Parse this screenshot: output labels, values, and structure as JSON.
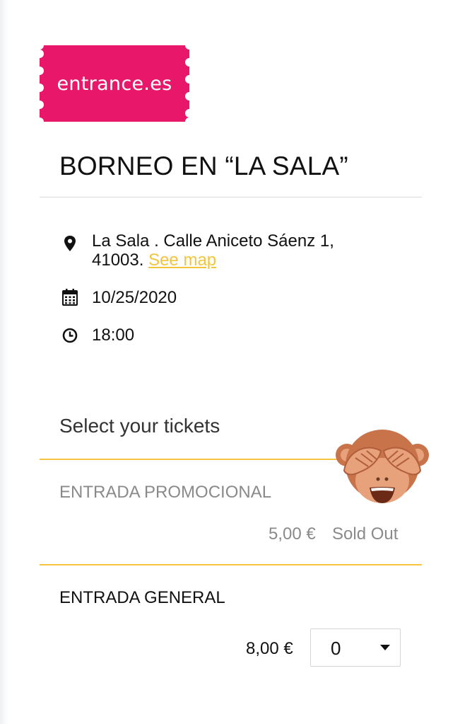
{
  "brand": {
    "logo_text": "entrance.es",
    "logo_color": "#e8176a"
  },
  "event": {
    "title": "BORNEO EN “LA SALA”",
    "address": "La Sala . Calle Aniceto Sáenz 1, 41003.",
    "see_map": "See map",
    "date": "10/25/2020",
    "time": "18:00"
  },
  "tickets": {
    "heading": "Select your tickets",
    "items": [
      {
        "name": "ENTRADA PROMOCIONAL",
        "price": "5,00 €",
        "status": "Sold Out"
      },
      {
        "name": "ENTRADA GENERAL",
        "price": "8,00 €",
        "quantity": "0"
      }
    ]
  },
  "icons": [
    "map-marker-icon",
    "calendar-icon",
    "clock-icon",
    "caret-down-icon",
    "see-no-evil-monkey-emoji"
  ],
  "colors": {
    "accent": "#f5c542",
    "link": "#f2c53d",
    "muted_text": "#8a8a8a"
  }
}
